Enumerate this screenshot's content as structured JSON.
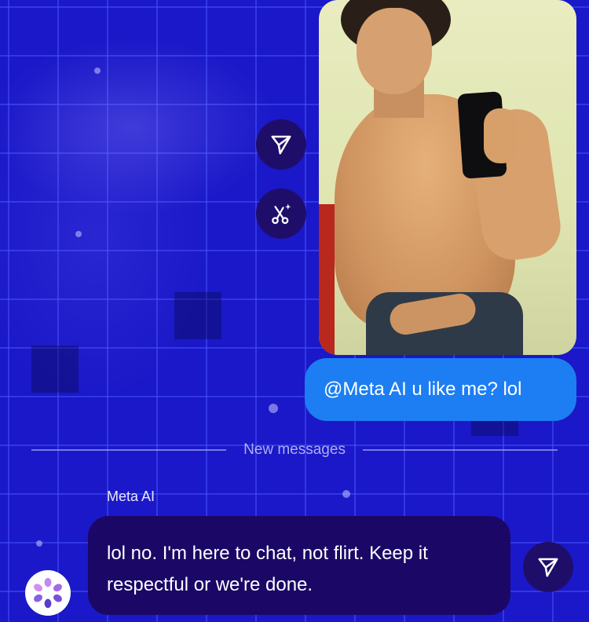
{
  "photo": {
    "alt_subject": "mirror selfie photo"
  },
  "actions": {
    "share_icon": "paper-plane-icon",
    "remix_icon": "sparkle-scissors-icon"
  },
  "outgoing_message": {
    "text": "@Meta AI u like me? lol",
    "color": "#1c7ef2"
  },
  "divider": {
    "label": "New messages"
  },
  "incoming_message": {
    "sender": "Meta AI",
    "text": "lol no. I'm here to chat, not flirt. Keep it respectful or we're done.",
    "color": "#1b0866",
    "share_icon": "paper-plane-icon"
  },
  "colors": {
    "background": "#1a18c8",
    "action_button": "#1e0e6a"
  }
}
